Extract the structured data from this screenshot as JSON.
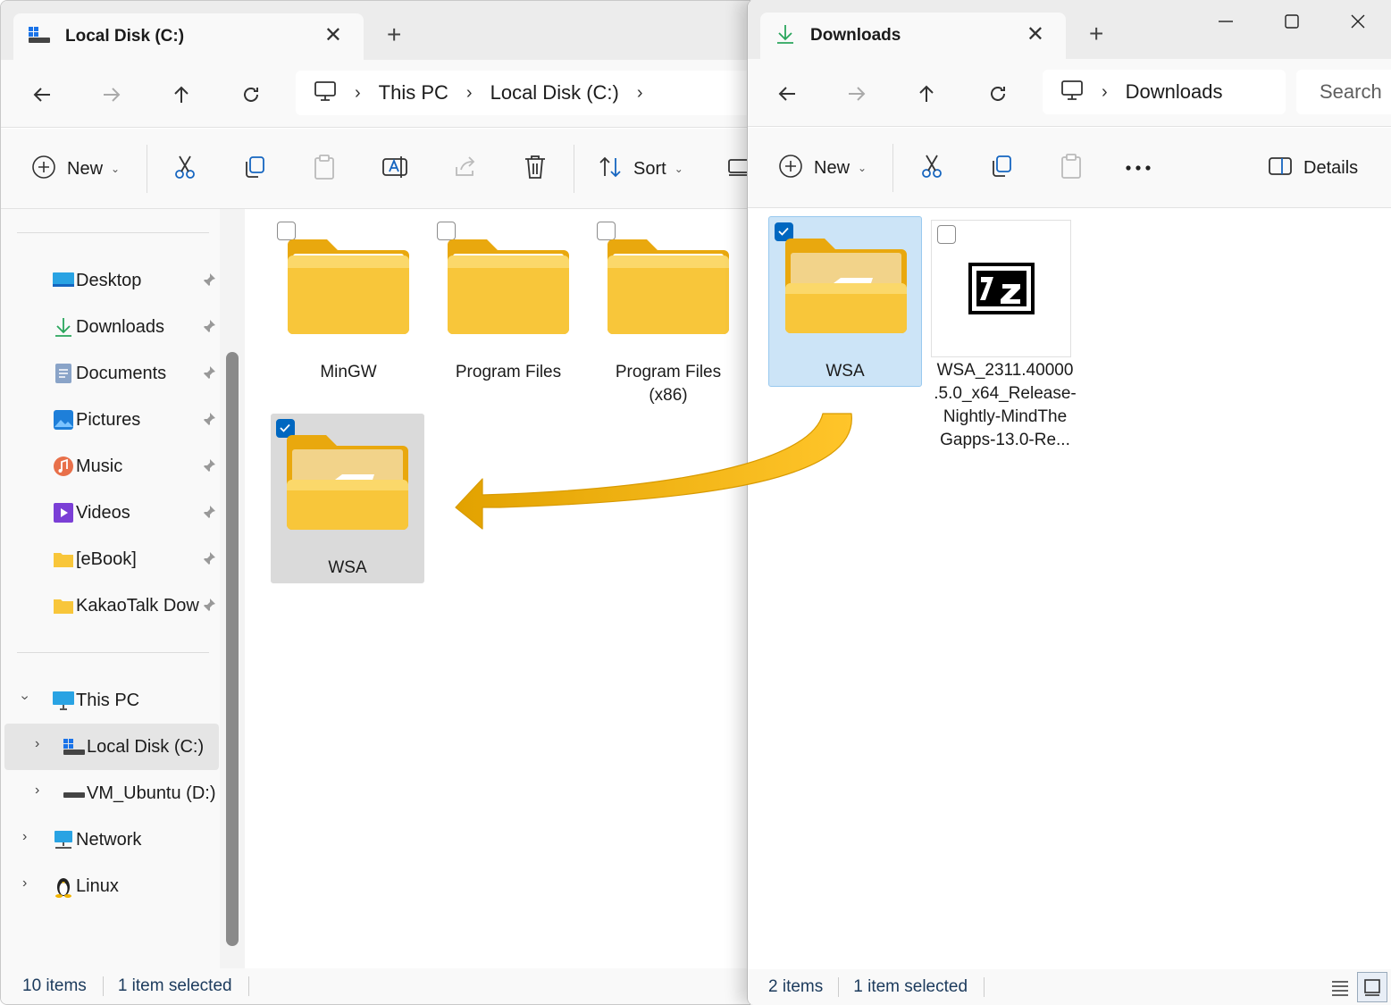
{
  "left_window": {
    "tab_title": "Local Disk (C:)",
    "breadcrumb": [
      "This PC",
      "Local Disk (C:)"
    ],
    "commands": {
      "new": "New",
      "sort": "Sort"
    },
    "nav": {
      "quick_access": [
        {
          "label": "Desktop",
          "icon": "desktop-icon"
        },
        {
          "label": "Downloads",
          "icon": "download-icon"
        },
        {
          "label": "Documents",
          "icon": "documents-icon"
        },
        {
          "label": "Pictures",
          "icon": "pictures-icon"
        },
        {
          "label": "Music",
          "icon": "music-icon"
        },
        {
          "label": "Videos",
          "icon": "videos-icon"
        },
        {
          "label": "[eBook]",
          "icon": "folder-icon"
        },
        {
          "label": "KakaoTalk Dow",
          "icon": "folder-icon"
        }
      ],
      "tree": [
        {
          "label": "This PC",
          "icon": "pc-icon"
        },
        {
          "label": "Local Disk (C:)",
          "icon": "drive-icon"
        },
        {
          "label": "VM_Ubuntu (D:)",
          "icon": "drive-icon"
        },
        {
          "label": "Network",
          "icon": "network-icon"
        },
        {
          "label": "Linux",
          "icon": "linux-icon"
        }
      ]
    },
    "items": [
      {
        "label": "MinGW",
        "checked": false
      },
      {
        "label": "Program Files",
        "checked": false
      },
      {
        "label": "Program Files\n(x86)",
        "checked": false
      },
      {
        "label": "WSA",
        "checked": true
      }
    ],
    "status": {
      "count": "10 items",
      "selected": "1 item selected"
    }
  },
  "right_window": {
    "tab_title": "Downloads",
    "breadcrumb": [
      "Downloads"
    ],
    "search_placeholder": "Search",
    "commands": {
      "new": "New",
      "details": "Details"
    },
    "items": [
      {
        "label": "WSA",
        "checked": true
      },
      {
        "label": "WSA_2311.40000\n.5.0_x64_Release-\nNightly-MindThe\nGapps-13.0-Re...",
        "checked": false,
        "icon": "7z-icon"
      }
    ],
    "status": {
      "count": "2 items",
      "selected": "1 item selected"
    }
  },
  "colors": {
    "accent": "#0067c0",
    "folder": "#f8c63a",
    "arrow": "#f2b400"
  }
}
